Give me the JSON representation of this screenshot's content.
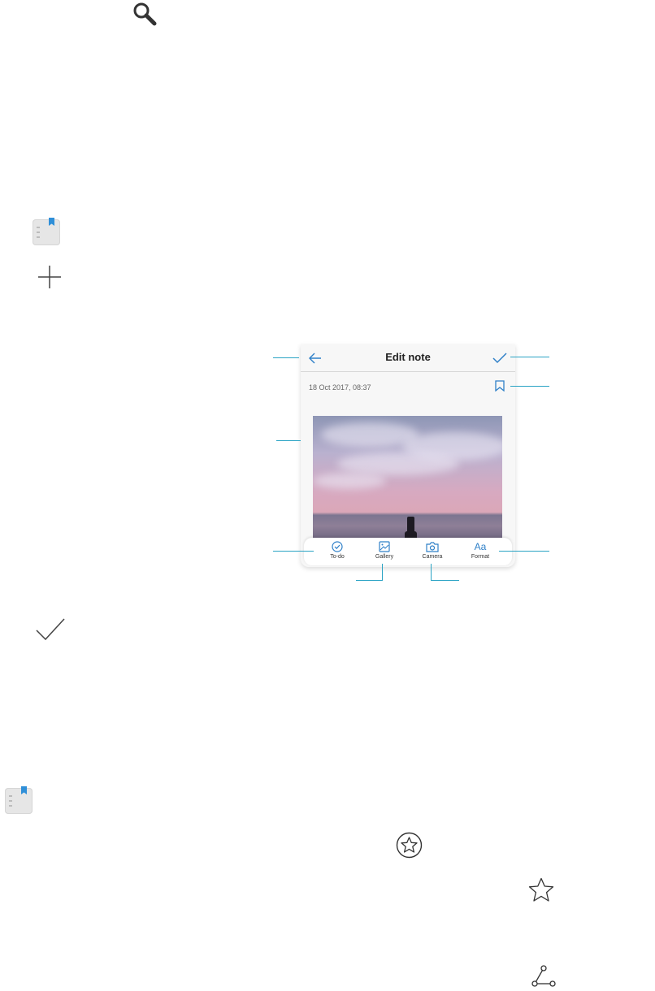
{
  "phone": {
    "title": "Edit note",
    "date": "18 Oct 2017, 08:37",
    "toolbar": {
      "todo": "To-do",
      "gallery": "Gallery",
      "camera": "Camera",
      "format_icon": "Aa",
      "format": "Format"
    }
  },
  "icons": [
    "search-icon",
    "notepad-app-icon",
    "plus-icon",
    "check-icon",
    "star-circle-icon",
    "star-icon",
    "share-icon"
  ],
  "colors": {
    "accent": "#2f80c8",
    "leader": "#2aa3c4",
    "notepad_tab": "#2f8fd8"
  }
}
